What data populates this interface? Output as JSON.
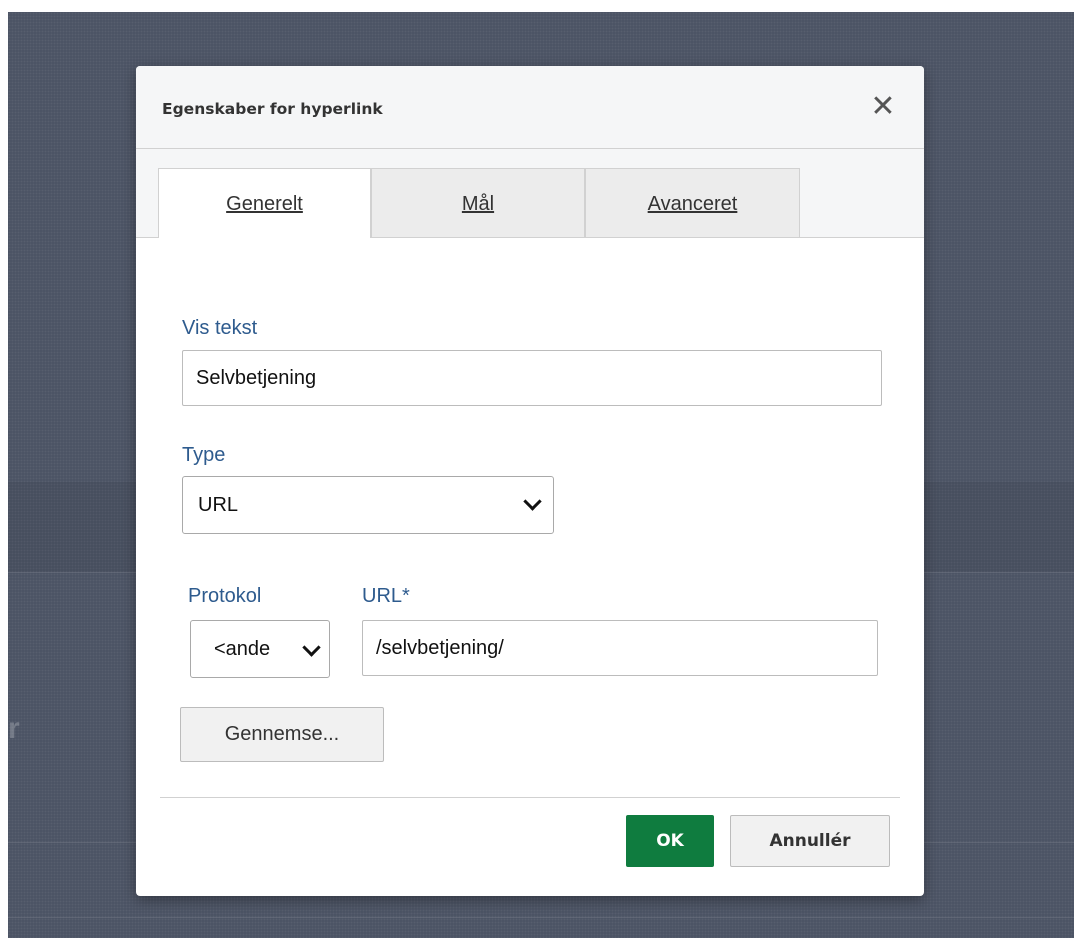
{
  "dialog": {
    "title": "Egenskaber for hyperlink",
    "close_icon": "close-icon"
  },
  "tabs": [
    {
      "label": "Generelt",
      "active": true
    },
    {
      "label": "Mål",
      "active": false
    },
    {
      "label": "Avanceret",
      "active": false
    }
  ],
  "form": {
    "display_text": {
      "label": "Vis tekst",
      "value": "Selvbetjening"
    },
    "type": {
      "label": "Type",
      "value": "URL"
    },
    "protocol": {
      "label": "Protokol",
      "value": "<ande"
    },
    "url": {
      "label": "URL*",
      "value": "/selvbetjening/"
    },
    "browse_label": "Gennemse..."
  },
  "footer": {
    "ok_label": "OK",
    "cancel_label": "Annullér"
  },
  "background": {
    "fragment_text": "r"
  },
  "colors": {
    "ok_button": "#0f7c3f",
    "label_text": "#2e5b8e",
    "backdrop": "#4a5263"
  }
}
